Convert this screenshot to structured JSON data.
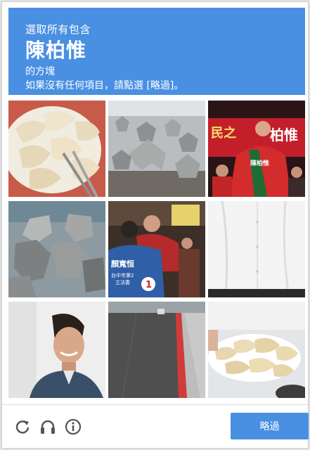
{
  "header": {
    "instruction": "選取所有包含",
    "target": "陳柏惟",
    "suffix": "的方塊",
    "hint": "如果沒有任何項目，請點選 [略過]。"
  },
  "tiles": [
    {
      "subject": "dumplings on plate with chopsticks"
    },
    {
      "subject": "concrete tetrapods on beach"
    },
    {
      "subject": "campaign rally, man in red with sash"
    },
    {
      "subject": "stacked concrete tetrapods"
    },
    {
      "subject": "rally crowd, hugging, blue campaign vest"
    },
    {
      "subject": "white shirt"
    },
    {
      "subject": "smiling man in denim shirt"
    },
    {
      "subject": "street with red curb"
    },
    {
      "subject": "plate of dumplings"
    }
  ],
  "sign_texts": {
    "rally_banner_a": "民之",
    "rally_banner_b": "柏惟",
    "rally_sash": "陳柏惟",
    "vest_name": "顏寬恒",
    "vest_sub": "台中市第2",
    "vest_sub2": "立法委",
    "vest_number": "1"
  },
  "footer": {
    "icons": [
      "reload-icon",
      "audio-icon",
      "info-icon"
    ],
    "skip_label": "略過"
  },
  "colors": {
    "accent": "#4a90e2"
  }
}
